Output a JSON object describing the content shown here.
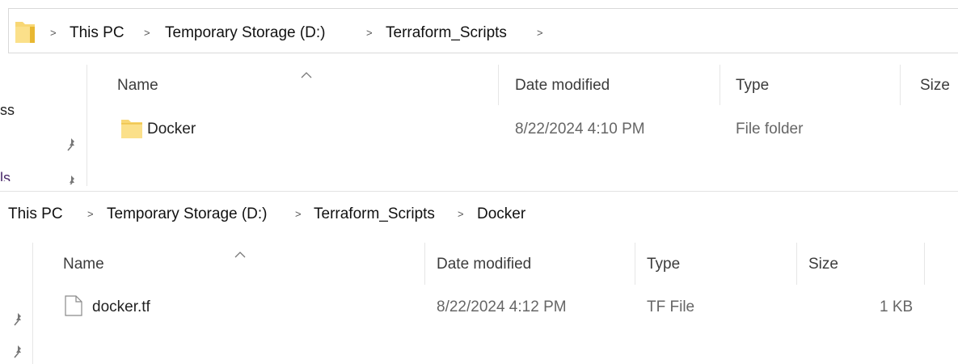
{
  "top_window": {
    "breadcrumb": [
      "This PC",
      "Temporary Storage (D:)",
      "Terraform_Scripts"
    ],
    "columns": {
      "name": "Name",
      "date": "Date modified",
      "type": "Type",
      "size": "Size"
    },
    "nav_fragments": [
      "ss",
      "ls"
    ],
    "rows": [
      {
        "name": "Docker",
        "date": "8/22/2024 4:10 PM",
        "type": "File folder",
        "size": ""
      }
    ]
  },
  "bottom_window": {
    "breadcrumb": [
      "This PC",
      "Temporary Storage (D:)",
      "Terraform_Scripts",
      "Docker"
    ],
    "columns": {
      "name": "Name",
      "date": "Date modified",
      "type": "Type",
      "size": "Size"
    },
    "rows": [
      {
        "name": "docker.tf",
        "date": "8/22/2024 4:12 PM",
        "type": "TF File",
        "size": "1 KB"
      }
    ]
  },
  "icons": {
    "folder": "folder-icon",
    "file": "file-icon",
    "pin": "pin-icon",
    "chevron": "chevron-right-icon",
    "sort": "sort-up-icon"
  },
  "colors": {
    "folder": "#f8d775",
    "folder_dark": "#e8b731",
    "divider": "#e3e3e3"
  }
}
